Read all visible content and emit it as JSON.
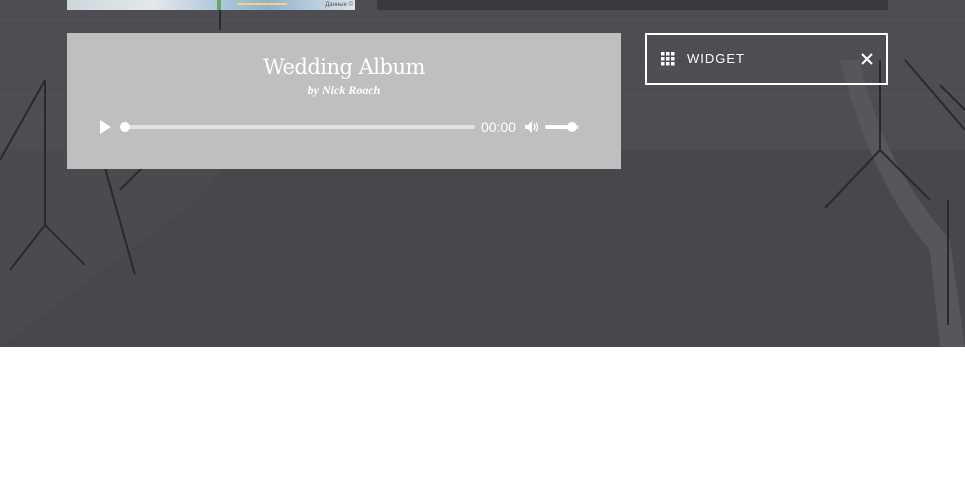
{
  "map": {
    "credit": "Данные ©"
  },
  "player": {
    "album_title": "Wedding Album",
    "album_author": "by Nick Roach",
    "time": "00:00",
    "progress": 0,
    "volume": 0.8
  },
  "widget": {
    "label": "WIDGET",
    "icon": "grid-icon",
    "close_icon": "close-icon"
  },
  "colors": {
    "stage_bg": "#4b4b50",
    "card_bg": "#bfbfbf",
    "text": "#ffffff",
    "page_bg": "#ffffff"
  }
}
